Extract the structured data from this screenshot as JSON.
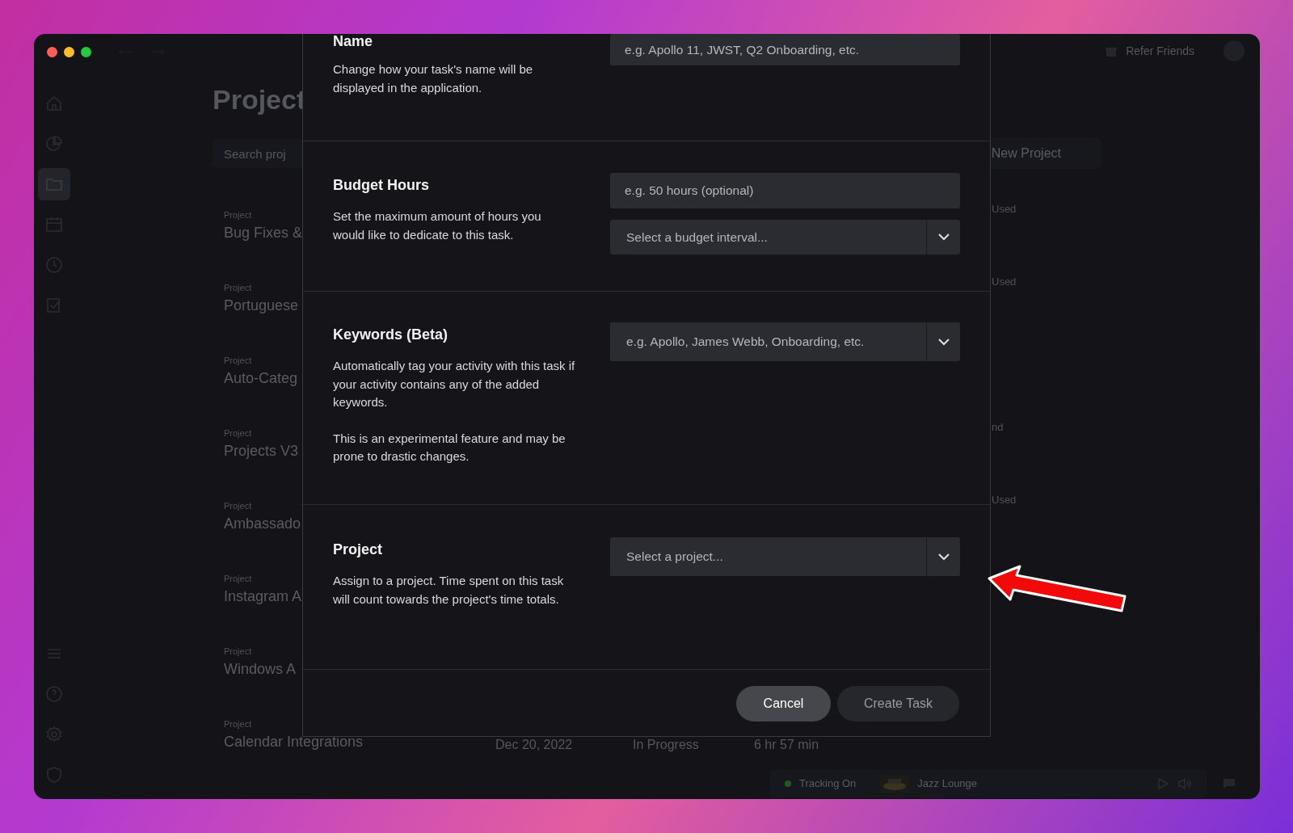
{
  "sidebar": {
    "items": [
      {
        "kind": "home",
        "selected": false
      },
      {
        "kind": "chart",
        "selected": false
      },
      {
        "kind": "folder",
        "selected": true
      },
      {
        "kind": "calendar",
        "selected": false
      },
      {
        "kind": "clock",
        "selected": false
      },
      {
        "kind": "check",
        "selected": false
      }
    ],
    "bottom_items": [
      {
        "kind": "menu"
      },
      {
        "kind": "help"
      },
      {
        "kind": "settings"
      },
      {
        "kind": "shield"
      }
    ]
  },
  "header": {
    "refer_label": "Refer Friends"
  },
  "page": {
    "title": "Project",
    "search_placeholder": "Search proj",
    "new_project": "New Project"
  },
  "projects": [
    {
      "label": "Project",
      "name": "Bug Fixes &",
      "right": "Used"
    },
    {
      "label": "Project",
      "name": "Portuguese",
      "right": "Used"
    },
    {
      "label": "Project",
      "name": "Auto-Categ"
    },
    {
      "label": "Project",
      "name": "Projects V3",
      "right": "nd"
    },
    {
      "label": "Project",
      "name": "Ambassado",
      "right": "Used"
    },
    {
      "label": "Project",
      "name": "Instagram A"
    },
    {
      "label": "Project",
      "name": "Windows A"
    },
    {
      "label": "Project",
      "name": "Calendar Integrations",
      "date": "Dec 20, 2022",
      "status": "In Progress",
      "time": "6 hr 57 min"
    }
  ],
  "player": {
    "tracking": "Tracking On",
    "tracking_on": true,
    "track": "Jazz Lounge"
  },
  "dialog": {
    "sections": [
      {
        "title": "Name",
        "description": [
          "Change how your task's name will be displayed in the application."
        ],
        "fields": [
          {
            "kind": "input",
            "placeholder": "e.g. Apollo 11, JWST, Q2 Onboarding, etc."
          }
        ]
      },
      {
        "title": "Budget Hours",
        "description": [
          "Set the maximum amount of hours you would like to dedicate to this task."
        ],
        "fields": [
          {
            "kind": "input",
            "placeholder": "e.g. 50 hours (optional)"
          },
          {
            "kind": "select",
            "placeholder": "Select a budget interval..."
          }
        ]
      },
      {
        "title": "Keywords (Beta)",
        "description": [
          "Automatically tag your activity with this task if your activity contains any of the added keywords.",
          "This is an experimental feature and may be prone to drastic changes."
        ],
        "fields": [
          {
            "kind": "select",
            "placeholder": "e.g. Apollo, James Webb, Onboarding, etc."
          }
        ]
      },
      {
        "title": "Project",
        "description": [
          "Assign to a project. Time spent on this task will count towards the project's time totals."
        ],
        "fields": [
          {
            "kind": "select",
            "placeholder": "Select a project..."
          }
        ]
      }
    ],
    "buttons": [
      {
        "label": "Cancel",
        "kind": "secondary"
      },
      {
        "label": "Create Task",
        "kind": "primary"
      }
    ]
  }
}
